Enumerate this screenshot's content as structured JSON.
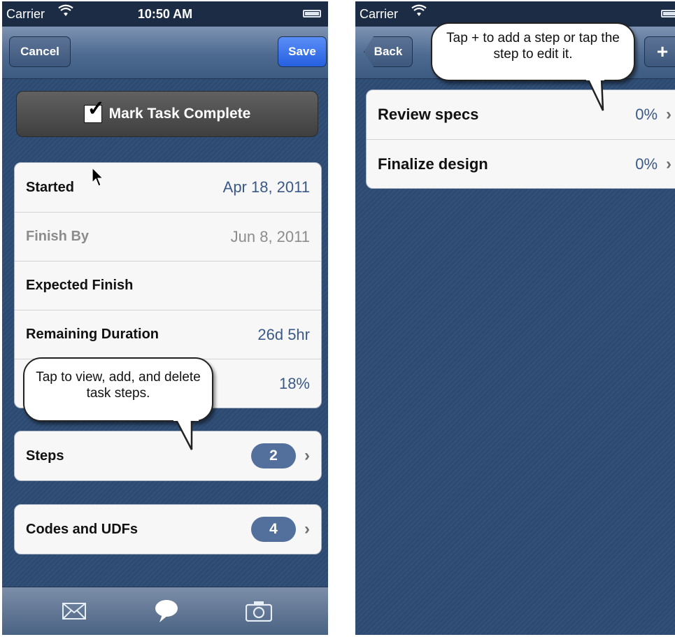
{
  "left_screen": {
    "status": {
      "carrier": "Carrier",
      "time": "10:50 AM"
    },
    "nav": {
      "cancel": "Cancel",
      "save": "Save"
    },
    "mark_complete": "Mark Task Complete",
    "rows": [
      {
        "label": "Started",
        "value": "Apr 18, 2011"
      },
      {
        "label": "Finish By",
        "value": "Jun 8, 2011"
      },
      {
        "label": "Expected Finish",
        "value": ""
      },
      {
        "label": "Remaining Duration",
        "value": "26d 5hr"
      },
      {
        "label": "",
        "value": "18%"
      }
    ],
    "steps": {
      "label": "Steps",
      "count": "2"
    },
    "codes": {
      "label": "Codes and UDFs",
      "count": "4"
    },
    "callout": "Tap to view, add, and delete task steps.",
    "tabs": [
      "mail-icon",
      "comment-icon",
      "camera-icon"
    ]
  },
  "right_screen": {
    "status": {
      "carrier": "Carrier"
    },
    "nav": {
      "back": "Back",
      "add": "+"
    },
    "callout": "Tap + to add a step or tap the step to edit it.",
    "steps": [
      {
        "name": "Review specs",
        "percent": "0%"
      },
      {
        "name": "Finalize design",
        "percent": "0%"
      }
    ]
  },
  "colors": {
    "nav_blue": "#4d6a90",
    "save_blue": "#2660e0",
    "value_blue": "#3a5988",
    "background": "#2c4a72"
  }
}
